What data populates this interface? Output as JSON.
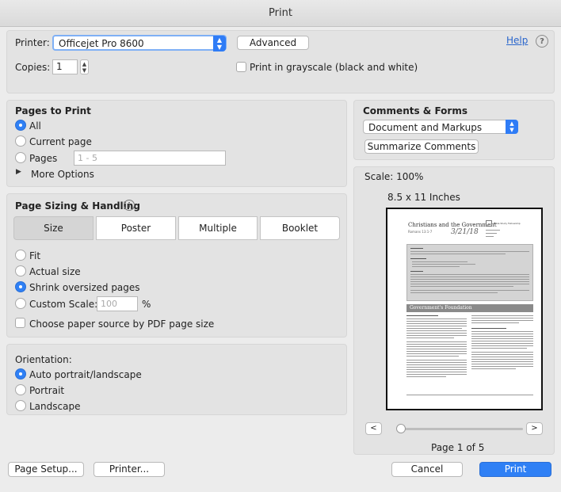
{
  "window": {
    "title": "Print"
  },
  "printer": {
    "label": "Printer:",
    "selected": "Officejet Pro 8600",
    "advanced_label": "Advanced",
    "help_label": "Help",
    "help_icon": "?"
  },
  "copies": {
    "label": "Copies:",
    "value": "1"
  },
  "grayscale": {
    "label": "Print in grayscale (black and white)",
    "checked": false
  },
  "pages_to_print": {
    "heading": "Pages to Print",
    "all_label": "All",
    "current_label": "Current page",
    "pages_label": "Pages",
    "pages_placeholder": "1 - 5",
    "more_options_label": "More Options",
    "selected": "All"
  },
  "sizing": {
    "heading": "Page Sizing & Handling",
    "info_icon": "i",
    "tabs": [
      "Size",
      "Poster",
      "Multiple",
      "Booklet"
    ],
    "selected_tab": "Size",
    "fit_label": "Fit",
    "actual_label": "Actual size",
    "shrink_label": "Shrink oversized pages",
    "custom_label": "Custom Scale:",
    "custom_value": "100",
    "percent": "%",
    "paper_source_label": "Choose paper source by PDF page size",
    "selected": "Shrink oversized pages"
  },
  "orientation": {
    "heading": "Orientation:",
    "auto_label": "Auto portrait/landscape",
    "portrait_label": "Portrait",
    "landscape_label": "Landscape",
    "selected": "Auto portrait/landscape"
  },
  "comments_forms": {
    "heading": "Comments & Forms",
    "selected": "Document and Markups",
    "summarize_label": "Summarize Comments"
  },
  "preview": {
    "scale_label": "Scale: 100%",
    "paper_size": "8.5 x 11 Inches",
    "doc_title": "Christians and the Government",
    "doc_ref": "Romans 13:1-7",
    "handwritten": "3/21/18",
    "brand": "Bible Study Fellowship",
    "section_heading": "Government's Foundation",
    "prev_label": "<",
    "next_label": ">",
    "page_indicator": "Page 1 of 5",
    "slider_position": 0
  },
  "footer": {
    "page_setup_label": "Page Setup...",
    "printer_label": "Printer...",
    "cancel_label": "Cancel",
    "print_label": "Print"
  }
}
